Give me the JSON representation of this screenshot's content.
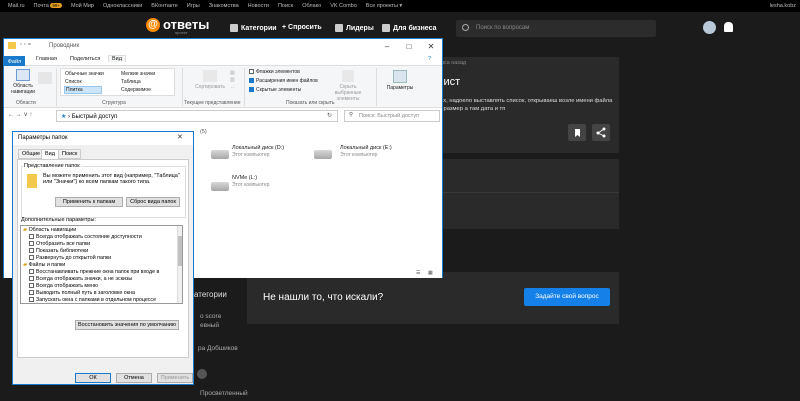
{
  "topbar": {
    "items": [
      "Mail.ru",
      "Почта",
      "Мой Мир",
      "Одноклассники",
      "ВКонтакте",
      "Игры",
      "Знакомства",
      "Новости",
      "Поиск",
      "Облако",
      "VK Combo",
      "Все проекты ▾"
    ],
    "mail_badge": "99+",
    "user": "lesha.kobz"
  },
  "header": {
    "logo": "ответы",
    "logo_sub": "проект",
    "nav": [
      "Категории",
      "+ Спросить",
      "Лидеры",
      "Для бизнеса"
    ],
    "search_placeholder": "Поиск по вопросам"
  },
  "question_card": {
    "meta": "часа назад",
    "title": "алист",
    "text": "апках, надоело выставлять список, открываеш возле имени файла был размер а там дата и тп"
  },
  "not_found": {
    "text": "Не нашли то, что искали?",
    "button": "Задайте свой вопрос"
  },
  "sidebar_bits": {
    "categories": "атегории",
    "item1": "о score",
    "item2": "евный",
    "item3": "ра Добшиков",
    "item4": "м",
    "item5": "Просветленный"
  },
  "explorer": {
    "title": "Проводник",
    "tabs": [
      "Файл",
      "Главная",
      "Поделиться",
      "Вид"
    ],
    "ribbon": {
      "nav_pane": "Область навигации",
      "areas_label": "Области",
      "layout_items": [
        "Обычные значки",
        "Мелкие значки",
        "Список",
        "Таблица",
        "Плитка",
        "Содержимое"
      ],
      "structure_label": "Структура",
      "sort": "Сортировать",
      "current_view_label": "Текущее представление",
      "checkboxes": [
        {
          "label": "Флажки элементов",
          "checked": false
        },
        {
          "label": "Расширения имен файлов",
          "checked": true
        },
        {
          "label": "Скрытые элементы",
          "checked": true
        }
      ],
      "hide_selected": "Скрыть выбранные элементы",
      "show_hide_label": "Показать или скрыть",
      "params": "Параметры"
    },
    "address": "Быстрый доступ",
    "search_placeholder": "Поиск: Быстрый доступ",
    "drives": [
      {
        "name": "Локальный диск (D:)",
        "sub": "Этот компьютер"
      },
      {
        "name": "Локальный диск (E:)",
        "sub": "Этот компьютер"
      },
      {
        "name": "NVMe (L:)",
        "sub": "Этот компьютер"
      }
    ],
    "partial_count": "(5)"
  },
  "dialog": {
    "title": "Параметры папок",
    "tabs": [
      "Общие",
      "Вид",
      "Поиск"
    ],
    "folder_view_group": "Представление папок",
    "folder_view_text": "Вы можете применить этот вид (например, \"Таблица\" или \"Значки\") ко всем папкам такого типа.",
    "apply_button": "Применить к папкам",
    "reset_button": "Сброс вида папок",
    "advanced_label": "Дополнительные параметры:",
    "advanced_items": [
      {
        "label": "Область навигации",
        "type": "folder"
      },
      {
        "label": "Всегда отображать состояние доступности",
        "type": "cb"
      },
      {
        "label": "Отобразить все папки",
        "type": "cb"
      },
      {
        "label": "Показать библиотеки",
        "type": "cb"
      },
      {
        "label": "Развернуть до открытой папки",
        "type": "cb"
      },
      {
        "label": "Файлы и папки",
        "type": "folder"
      },
      {
        "label": "Восстанавливать прежние окна папок при входе в",
        "type": "cb"
      },
      {
        "label": "Всегда отображать значки, а не эскизы",
        "type": "cb"
      },
      {
        "label": "Всегда отображать меню",
        "type": "cb"
      },
      {
        "label": "Выводить полный путь в заголовке окна",
        "type": "cb"
      },
      {
        "label": "Запускать окна с папками в отдельном процессе",
        "type": "cb"
      }
    ],
    "restore_button": "Восстановить значения по умолчанию",
    "ok": "ОК",
    "cancel": "Отмена",
    "apply": "Применить"
  }
}
